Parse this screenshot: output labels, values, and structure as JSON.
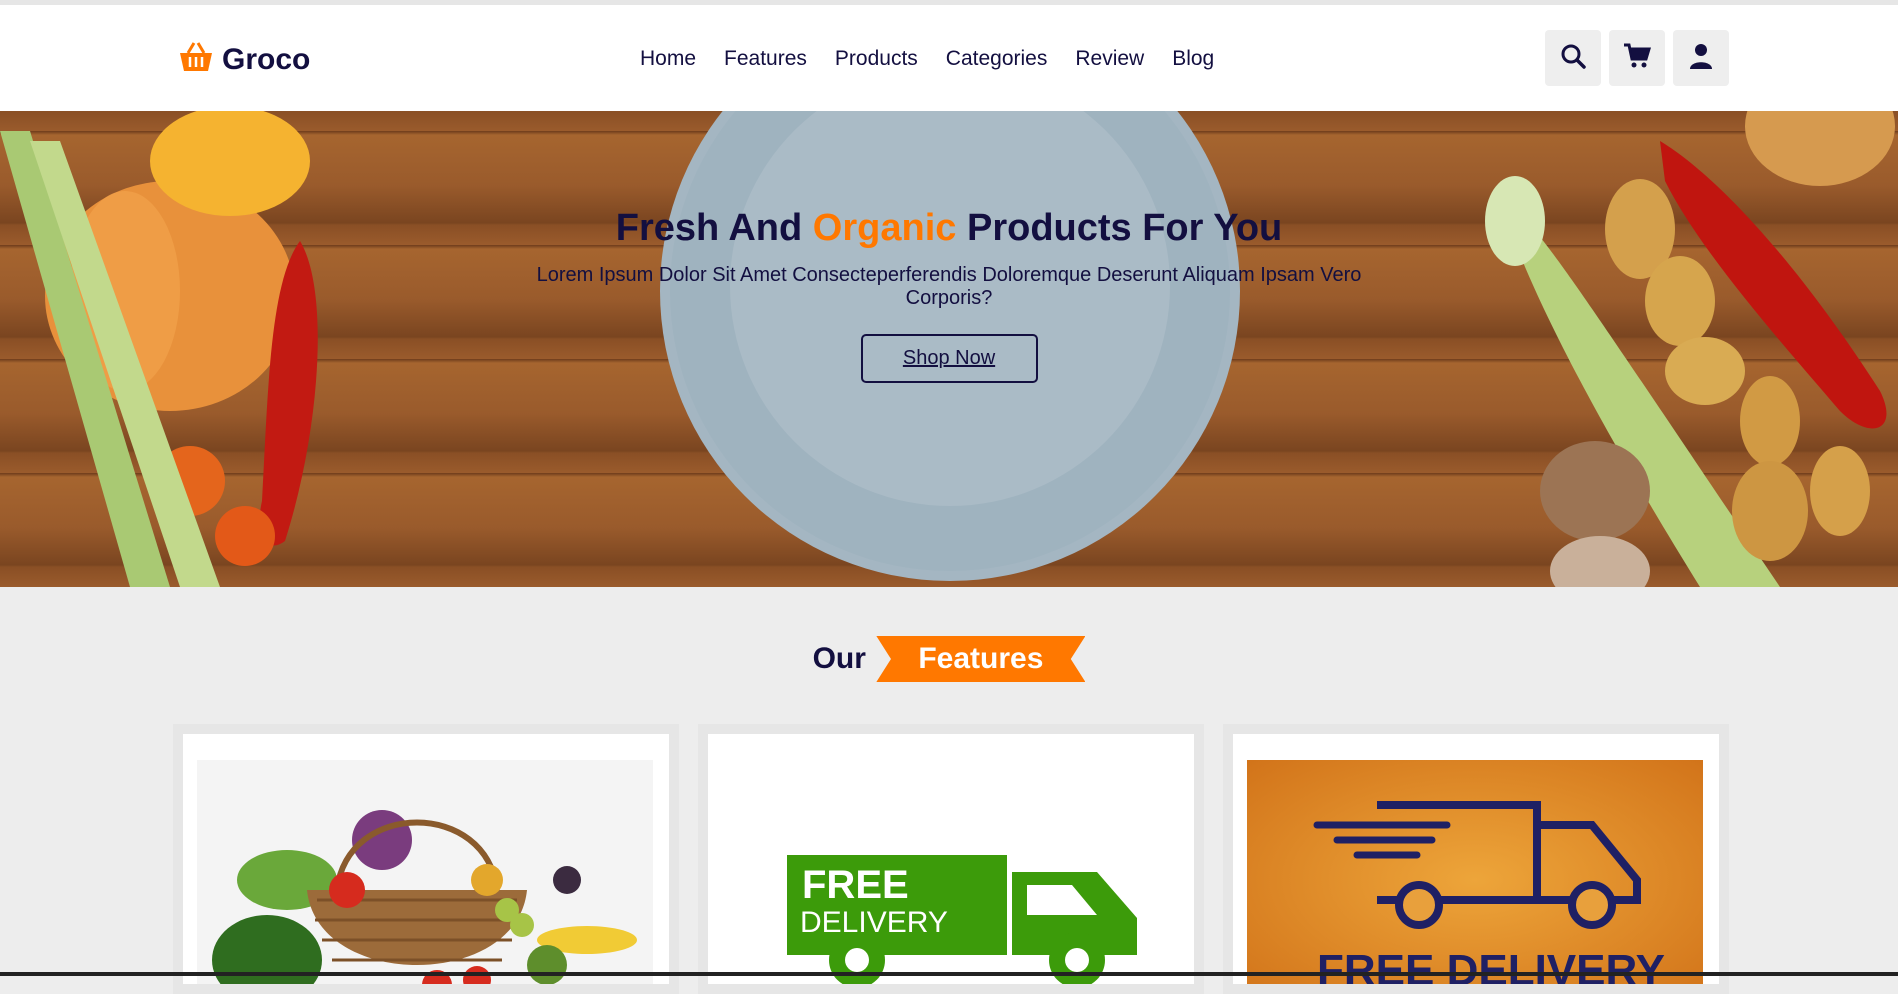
{
  "header": {
    "logo_text": "Groco",
    "nav": [
      "Home",
      "Features",
      "Products",
      "Categories",
      "Review",
      "Blog"
    ],
    "icons": [
      "search-icon",
      "cart-icon",
      "user-icon"
    ]
  },
  "hero": {
    "title_part1": "Fresh And",
    "title_highlight": "Organic",
    "title_part2": "Products For You",
    "subtitle": "Lorem Ipsum Dolor Sit Amet Consecteperferendis Doloremque Deserunt Aliquam Ipsam Vero Corporis?",
    "button": "Shop Now"
  },
  "features": {
    "heading_plain": "Our",
    "heading_badge": "Features",
    "cards": [
      {
        "image": "vegetable-basket"
      },
      {
        "image": "free-delivery-truck-green",
        "image_text_1": "FREE",
        "image_text_2": "DELIVERY"
      },
      {
        "image": "free-delivery-truck-orange",
        "image_text": "FREE DELIVERY"
      }
    ]
  },
  "colors": {
    "primary": "#130f40",
    "accent": "#ff7800",
    "green": "#3c9b0a"
  }
}
